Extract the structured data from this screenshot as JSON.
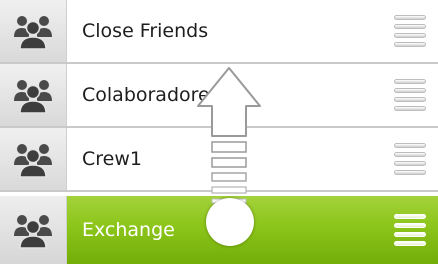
{
  "groups": [
    {
      "label": "Close Friends",
      "icon": "group-icon",
      "selected": false
    },
    {
      "label": "Colaboradores",
      "icon": "group-icon",
      "selected": false
    },
    {
      "label": "Crew1",
      "icon": "group-icon",
      "selected": false
    },
    {
      "label": "Exchange",
      "icon": "group-icon",
      "selected": true
    }
  ],
  "colors": {
    "selected_row": "#8cc51a",
    "divider": "#c9c9c9",
    "avatar_bg": "#e4e4e4",
    "icon": "#4a4a4a"
  },
  "gesture": {
    "icon": "swipe-up-arrow-icon",
    "direction": "up"
  }
}
